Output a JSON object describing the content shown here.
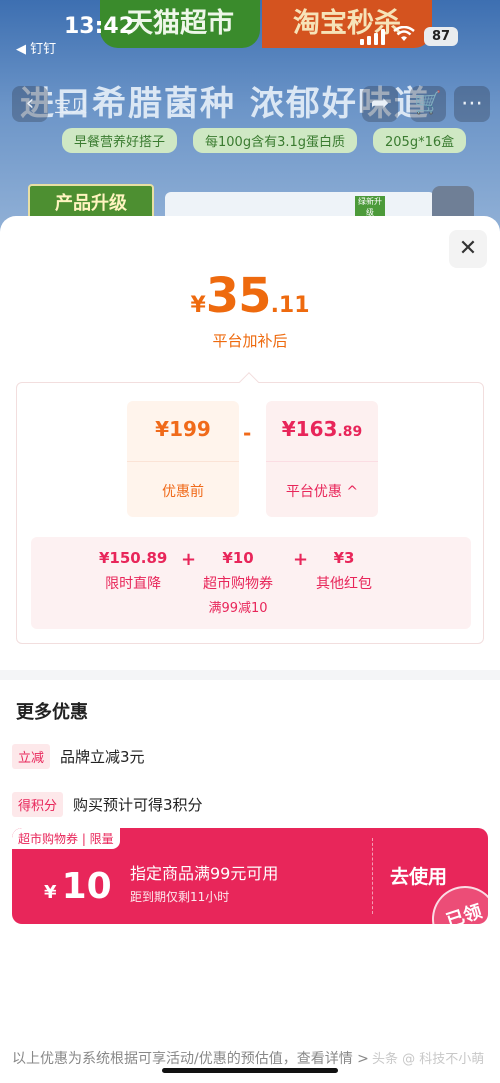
{
  "status_bar": {
    "time": "13:42",
    "back_app": "◀ 钉钉",
    "battery": "87"
  },
  "background": {
    "banner_left": "天猫超市",
    "banner_right": "淘宝秒杀",
    "nav_back_label": "宝贝",
    "headline": "进口希腊菌种 浓郁好味道",
    "tags": [
      "早餐营养好搭子",
      "每100g含有3.1g蛋白质",
      "205g*16盒"
    ],
    "upgrade_badge": "产品升级",
    "box_label": "绿新升级"
  },
  "sheet": {
    "close_label": "✕",
    "final_price": {
      "symbol": "¥",
      "integer": "35",
      "decimal": ".11"
    },
    "final_caption": "平台加补后",
    "before_price": {
      "value": "¥199",
      "label": "优惠前"
    },
    "minus": "-",
    "platform_discount": {
      "value": "¥163",
      "value_decimal": ".89",
      "label": "平台优惠",
      "chevron": "^"
    },
    "sub_items": [
      {
        "amount": "¥150.89",
        "name": "限时直降",
        "note": ""
      },
      {
        "amount": "¥10",
        "name": "超市购物券",
        "note": "满99减10"
      },
      {
        "amount": "¥3",
        "name": "其他红包",
        "note": ""
      }
    ],
    "plus": "+",
    "more_title": "更多优惠",
    "promos": [
      {
        "tag": "立减",
        "text": "品牌立减3元"
      },
      {
        "tag": "得积分",
        "text": "购买预计可得3积分"
      }
    ],
    "coupon": {
      "badge": "超市购物券 | 限量",
      "symbol": "¥",
      "amount": "10",
      "condition": "指定商品满99元可用",
      "expire": "距到期仅剩11小时",
      "action": "去使用",
      "stamp": "已领"
    },
    "footer_note": "以上优惠为系统根据可享活动/优惠的预估值，查看详情 >",
    "watermark": "头条 @ 科技不小萌"
  },
  "colors": {
    "accent_orange": "#ee6a0e",
    "accent_red": "#e8265a",
    "coupon_bg": "#e8265a"
  }
}
